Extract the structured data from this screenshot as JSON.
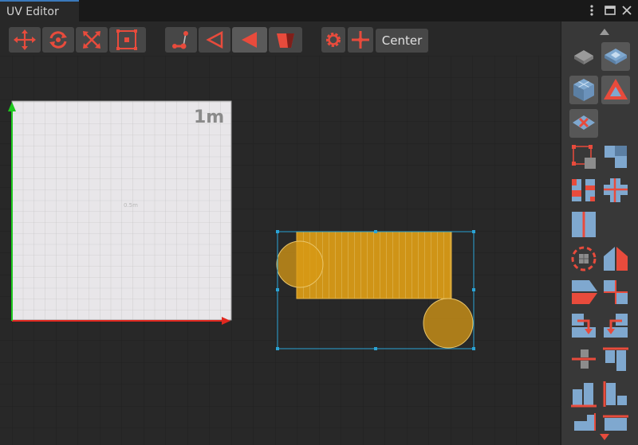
{
  "window": {
    "tab_title": "UV Editor",
    "controls": [
      "menu-icon",
      "maximize-icon",
      "close-icon"
    ]
  },
  "toolbar": {
    "tools": [
      {
        "name": "move-tool",
        "icon": "move-arrows-icon"
      },
      {
        "name": "rotate-tool",
        "icon": "rotate-icon"
      },
      {
        "name": "scale-tool",
        "icon": "scale-icon"
      },
      {
        "name": "rect-tool",
        "icon": "rect-select-icon"
      },
      {
        "name": "vertex-mode",
        "icon": "vertex-icon"
      },
      {
        "name": "edge-mode",
        "icon": "edge-icon"
      },
      {
        "name": "face-mode",
        "icon": "face-icon",
        "active": true
      },
      {
        "name": "object-mode",
        "icon": "object-icon"
      },
      {
        "name": "settings",
        "icon": "gear-icon"
      },
      {
        "name": "pivot",
        "icon": "pivot-crosshair-icon"
      }
    ],
    "pivot_label": "Center"
  },
  "canvas": {
    "unit_label": "1m",
    "half_label": "0.5m",
    "colors": {
      "background": "#282828",
      "uv_tile": "#e8e6e9",
      "axis_x": "#e0281f",
      "axis_y": "#1ec81e",
      "selection": "#2aa4d6",
      "uv_fill": "#d89a16"
    }
  },
  "sidepanel": {
    "tools": [
      "scroll-up-icon",
      "planar-project-icon",
      "box-project-icon",
      "cube-project-icon",
      "triangle-project-icon",
      "reset-uv-icon",
      "select-island-icon",
      "stitch-icon",
      "split-icon",
      "weld-icon",
      "collapse-icon",
      "fit-icon",
      "mirror-horizontal-icon",
      "mirror-vertical-icon",
      "align-left-icon",
      "align-right-icon",
      "flip-left-icon",
      "flip-right-icon",
      "distribute-icon",
      "align-top-icon",
      "bars-bottom-icon",
      "bars-left-icon",
      "scroll-down-icon"
    ]
  }
}
